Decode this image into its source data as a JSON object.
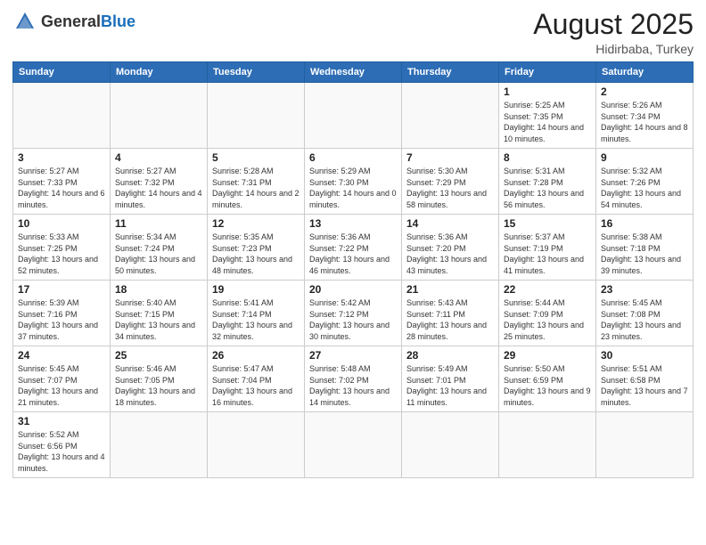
{
  "header": {
    "logo_general": "General",
    "logo_blue": "Blue",
    "month_title": "August 2025",
    "location": "Hidirbaba, Turkey"
  },
  "weekdays": [
    "Sunday",
    "Monday",
    "Tuesday",
    "Wednesday",
    "Thursday",
    "Friday",
    "Saturday"
  ],
  "weeks": [
    [
      {
        "day": "",
        "info": ""
      },
      {
        "day": "",
        "info": ""
      },
      {
        "day": "",
        "info": ""
      },
      {
        "day": "",
        "info": ""
      },
      {
        "day": "",
        "info": ""
      },
      {
        "day": "1",
        "info": "Sunrise: 5:25 AM\nSunset: 7:35 PM\nDaylight: 14 hours\nand 10 minutes."
      },
      {
        "day": "2",
        "info": "Sunrise: 5:26 AM\nSunset: 7:34 PM\nDaylight: 14 hours\nand 8 minutes."
      }
    ],
    [
      {
        "day": "3",
        "info": "Sunrise: 5:27 AM\nSunset: 7:33 PM\nDaylight: 14 hours\nand 6 minutes."
      },
      {
        "day": "4",
        "info": "Sunrise: 5:27 AM\nSunset: 7:32 PM\nDaylight: 14 hours\nand 4 minutes."
      },
      {
        "day": "5",
        "info": "Sunrise: 5:28 AM\nSunset: 7:31 PM\nDaylight: 14 hours\nand 2 minutes."
      },
      {
        "day": "6",
        "info": "Sunrise: 5:29 AM\nSunset: 7:30 PM\nDaylight: 14 hours\nand 0 minutes."
      },
      {
        "day": "7",
        "info": "Sunrise: 5:30 AM\nSunset: 7:29 PM\nDaylight: 13 hours\nand 58 minutes."
      },
      {
        "day": "8",
        "info": "Sunrise: 5:31 AM\nSunset: 7:28 PM\nDaylight: 13 hours\nand 56 minutes."
      },
      {
        "day": "9",
        "info": "Sunrise: 5:32 AM\nSunset: 7:26 PM\nDaylight: 13 hours\nand 54 minutes."
      }
    ],
    [
      {
        "day": "10",
        "info": "Sunrise: 5:33 AM\nSunset: 7:25 PM\nDaylight: 13 hours\nand 52 minutes."
      },
      {
        "day": "11",
        "info": "Sunrise: 5:34 AM\nSunset: 7:24 PM\nDaylight: 13 hours\nand 50 minutes."
      },
      {
        "day": "12",
        "info": "Sunrise: 5:35 AM\nSunset: 7:23 PM\nDaylight: 13 hours\nand 48 minutes."
      },
      {
        "day": "13",
        "info": "Sunrise: 5:36 AM\nSunset: 7:22 PM\nDaylight: 13 hours\nand 46 minutes."
      },
      {
        "day": "14",
        "info": "Sunrise: 5:36 AM\nSunset: 7:20 PM\nDaylight: 13 hours\nand 43 minutes."
      },
      {
        "day": "15",
        "info": "Sunrise: 5:37 AM\nSunset: 7:19 PM\nDaylight: 13 hours\nand 41 minutes."
      },
      {
        "day": "16",
        "info": "Sunrise: 5:38 AM\nSunset: 7:18 PM\nDaylight: 13 hours\nand 39 minutes."
      }
    ],
    [
      {
        "day": "17",
        "info": "Sunrise: 5:39 AM\nSunset: 7:16 PM\nDaylight: 13 hours\nand 37 minutes."
      },
      {
        "day": "18",
        "info": "Sunrise: 5:40 AM\nSunset: 7:15 PM\nDaylight: 13 hours\nand 34 minutes."
      },
      {
        "day": "19",
        "info": "Sunrise: 5:41 AM\nSunset: 7:14 PM\nDaylight: 13 hours\nand 32 minutes."
      },
      {
        "day": "20",
        "info": "Sunrise: 5:42 AM\nSunset: 7:12 PM\nDaylight: 13 hours\nand 30 minutes."
      },
      {
        "day": "21",
        "info": "Sunrise: 5:43 AM\nSunset: 7:11 PM\nDaylight: 13 hours\nand 28 minutes."
      },
      {
        "day": "22",
        "info": "Sunrise: 5:44 AM\nSunset: 7:09 PM\nDaylight: 13 hours\nand 25 minutes."
      },
      {
        "day": "23",
        "info": "Sunrise: 5:45 AM\nSunset: 7:08 PM\nDaylight: 13 hours\nand 23 minutes."
      }
    ],
    [
      {
        "day": "24",
        "info": "Sunrise: 5:45 AM\nSunset: 7:07 PM\nDaylight: 13 hours\nand 21 minutes."
      },
      {
        "day": "25",
        "info": "Sunrise: 5:46 AM\nSunset: 7:05 PM\nDaylight: 13 hours\nand 18 minutes."
      },
      {
        "day": "26",
        "info": "Sunrise: 5:47 AM\nSunset: 7:04 PM\nDaylight: 13 hours\nand 16 minutes."
      },
      {
        "day": "27",
        "info": "Sunrise: 5:48 AM\nSunset: 7:02 PM\nDaylight: 13 hours\nand 14 minutes."
      },
      {
        "day": "28",
        "info": "Sunrise: 5:49 AM\nSunset: 7:01 PM\nDaylight: 13 hours\nand 11 minutes."
      },
      {
        "day": "29",
        "info": "Sunrise: 5:50 AM\nSunset: 6:59 PM\nDaylight: 13 hours\nand 9 minutes."
      },
      {
        "day": "30",
        "info": "Sunrise: 5:51 AM\nSunset: 6:58 PM\nDaylight: 13 hours\nand 7 minutes."
      }
    ],
    [
      {
        "day": "31",
        "info": "Sunrise: 5:52 AM\nSunset: 6:56 PM\nDaylight: 13 hours\nand 4 minutes."
      },
      {
        "day": "",
        "info": ""
      },
      {
        "day": "",
        "info": ""
      },
      {
        "day": "",
        "info": ""
      },
      {
        "day": "",
        "info": ""
      },
      {
        "day": "",
        "info": ""
      },
      {
        "day": "",
        "info": ""
      }
    ]
  ]
}
